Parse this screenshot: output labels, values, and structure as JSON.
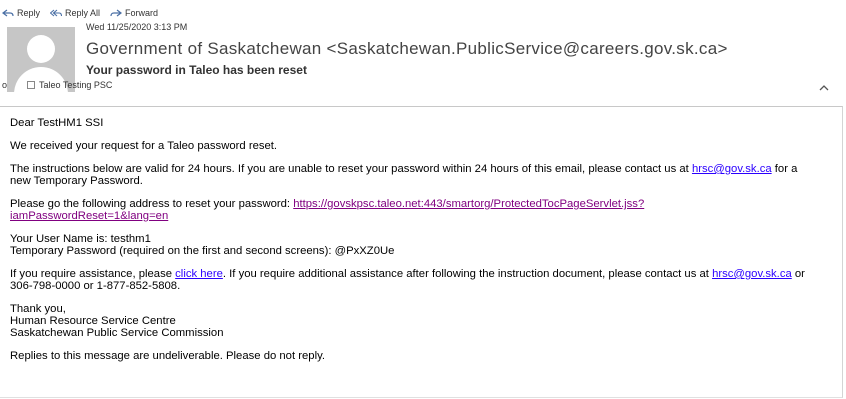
{
  "toolbar": {
    "reply": "Reply",
    "reply_all": "Reply All",
    "forward": "Forward"
  },
  "header": {
    "date": "Wed 11/25/2020 3:13 PM",
    "sender": "Government of Saskatchewan <Saskatchewan.PublicService@careers.gov.sk.ca>",
    "subject": "Your password in Taleo has been reset",
    "recipient_prefix": "o",
    "recipient": "Taleo Testing PSC"
  },
  "body": {
    "greeting": "Dear TestHM1 SSI",
    "p1": "We received your request for a Taleo password reset.",
    "p2_text": "The instructions below are valid for 24 hours.  If you are unable to reset your password within 24 hours of this email, please contact us at ",
    "p2_email": "hrsc@gov.sk.ca",
    "p2_end": " for a new Temporary Password.",
    "p3_text": "Please go the following address to reset your password:  ",
    "p3_link_line1": "https://govskpsc.taleo.net:443/smartorg/ProtectedTocPageServlet.jss?",
    "p3_link_line2": "iamPasswordReset=1&lang=en",
    "username_line": "Your User Name is:  testhm1",
    "password_line": "Temporary Password (required on the first and second screens):  @PxXZ0Ue",
    "p5_text": "If you require assistance, please ",
    "p5_link": "click here",
    "p5_mid": ".  If you require additional assistance after following the instruction document, please contact us at ",
    "p5_email": "hrsc@gov.sk.ca",
    "p5_end": " or 306-798-0000 or 1-877-852-5808.",
    "thanks": "Thank you,",
    "sig1": "Human Resource Service Centre",
    "sig2": "Saskatchewan Public Service Commission",
    "footer": "Replies to this message are undeliverable. Please do not reply."
  },
  "colors": {
    "link": "#2b00ff",
    "visited_link": "#800080",
    "avatar_bg": "#c6c6c6"
  }
}
